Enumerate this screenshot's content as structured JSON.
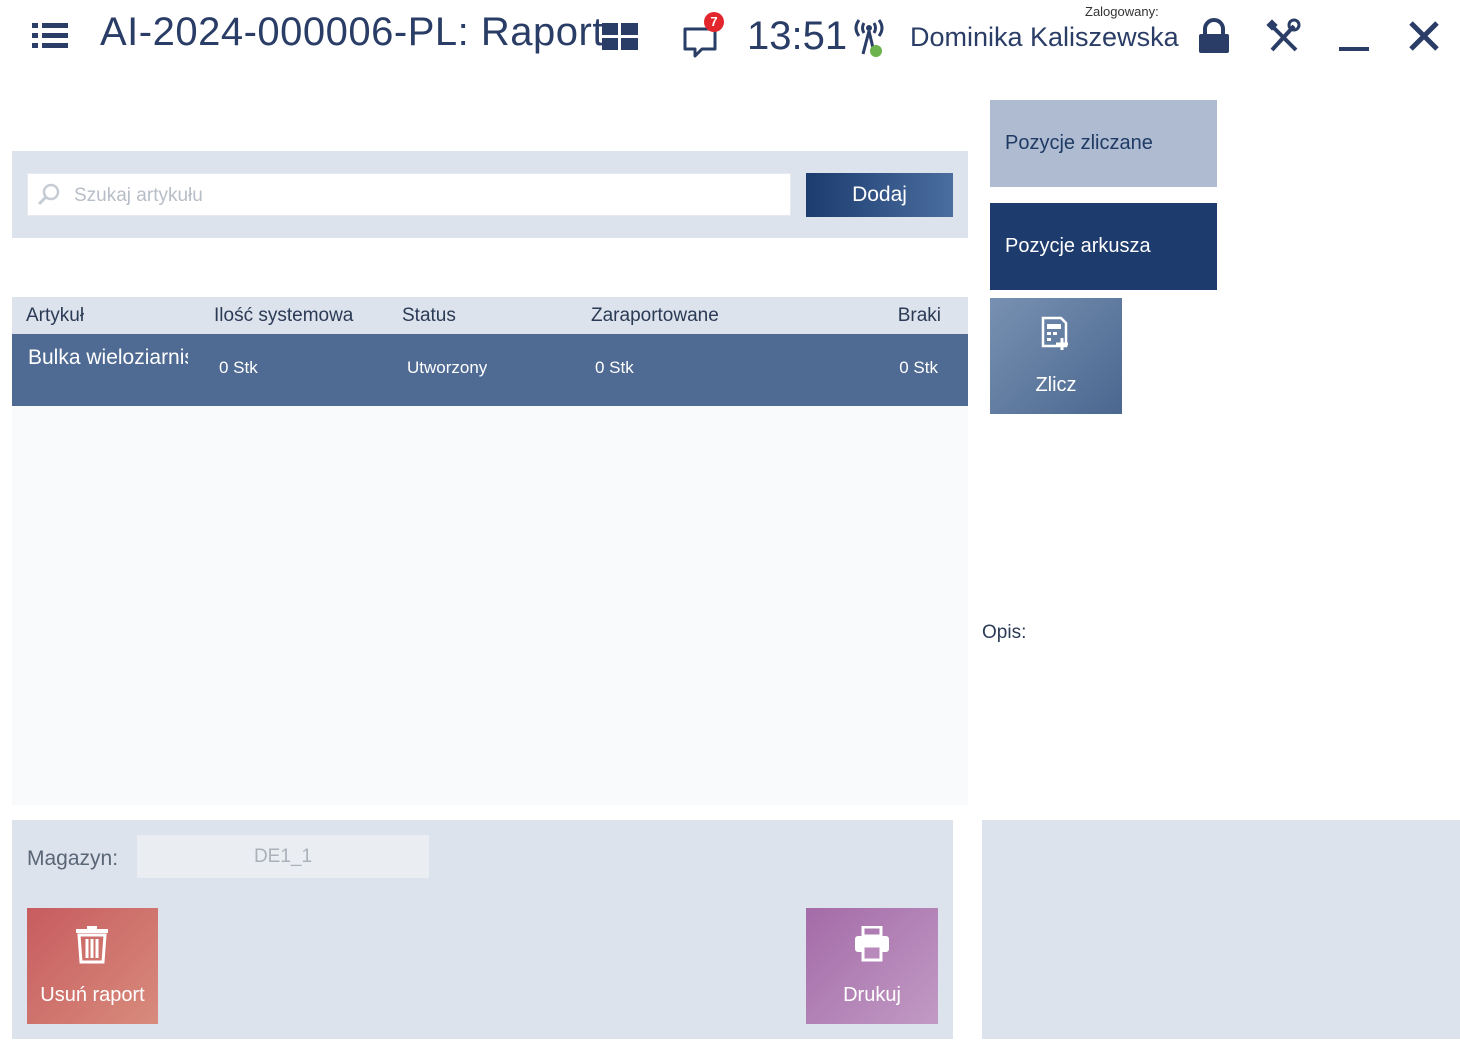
{
  "header": {
    "title": "AI-2024-000006-PL: Raport",
    "notification_count": "7",
    "time": "13:51",
    "logged_in_label": "Zalogowany:",
    "user_name": "Dominika Kaliszewska"
  },
  "search": {
    "placeholder": "Szukaj artykułu",
    "value": "",
    "add_label": "Dodaj"
  },
  "table": {
    "columns": [
      "Artykuł",
      "Ilość systemowa",
      "Status",
      "Zaraportowane",
      "Braki"
    ],
    "rows": [
      {
        "article": "Bulka wieloziarnista",
        "system_qty": "0 Stk",
        "status": "Utworzony",
        "reported": "0 Stk",
        "shortage": "0 Stk"
      }
    ]
  },
  "tiles": {
    "counted": "Pozycje zliczane",
    "sheet": "Pozycje arkusza",
    "count": "Zlicz"
  },
  "description_label": "Opis:",
  "footer": {
    "warehouse_label": "Magazyn:",
    "warehouse_value": "DE1_1",
    "delete_label": "Usuń raport",
    "print_label": "Drukuj"
  },
  "colors": {
    "accent": "#1d3b6c",
    "selected_row": "#4f6a93",
    "panel_bg": "#dce3ec",
    "delete": "#c75c5f",
    "print": "#a46ba8",
    "badge": "#e2262b"
  },
  "icons": [
    "menu-icon",
    "tiles-icon",
    "messages-icon",
    "signal-icon",
    "lock-icon",
    "tools-icon",
    "minimize-icon",
    "close-icon",
    "search-icon",
    "count-icon",
    "trash-icon",
    "printer-icon"
  ]
}
